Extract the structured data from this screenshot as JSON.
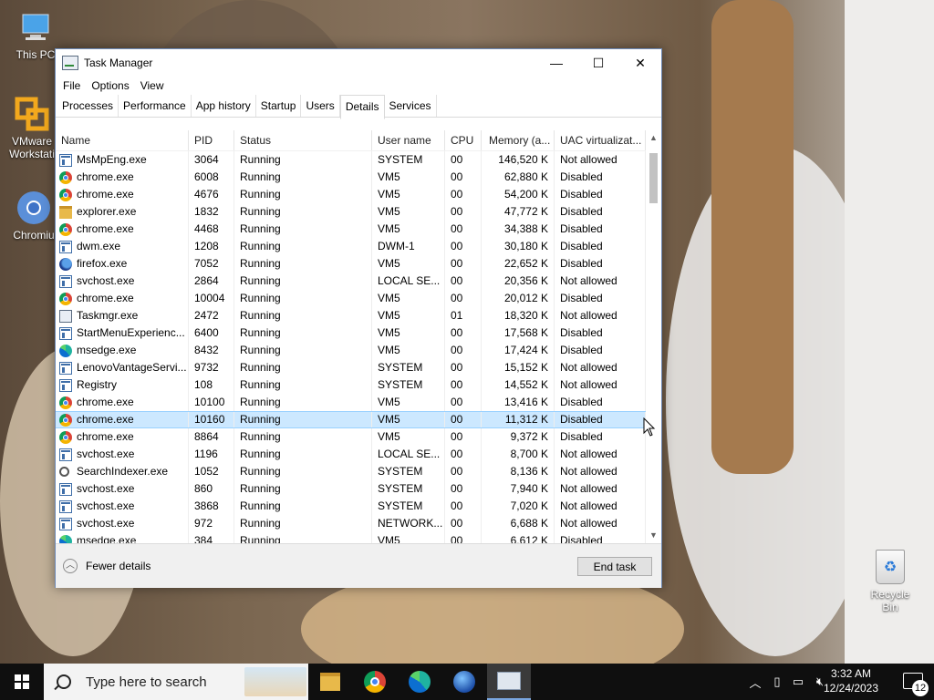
{
  "desktop": {
    "icons": [
      {
        "label": "This PC",
        "icon": "this-pc-icon"
      },
      {
        "label": "VMware Workstati",
        "icon": "vmware-icon"
      },
      {
        "label": "Chromiu",
        "icon": "chromium-icon"
      }
    ],
    "recycle_bin": {
      "label": "Recycle Bin",
      "icon": "recycle-bin-icon"
    }
  },
  "window": {
    "title": "Task Manager",
    "controls": {
      "minimize": "—",
      "maximize": "☐",
      "close": "✕"
    },
    "menu": [
      "File",
      "Options",
      "View"
    ],
    "tabs": [
      "Processes",
      "Performance",
      "App history",
      "Startup",
      "Users",
      "Details",
      "Services"
    ],
    "active_tab": "Details",
    "columns": {
      "name": "Name",
      "pid": "PID",
      "status": "Status",
      "user": "User name",
      "cpu": "CPU",
      "memory": "Memory (a...",
      "uac": "UAC virtualizat..."
    },
    "rows": [
      {
        "icon": "win",
        "name": "MsMpEng.exe",
        "pid": "3064",
        "status": "Running",
        "user": "SYSTEM",
        "cpu": "00",
        "memory": "146,520 K",
        "uac": "Not allowed"
      },
      {
        "icon": "chrome",
        "name": "chrome.exe",
        "pid": "6008",
        "status": "Running",
        "user": "VM5",
        "cpu": "00",
        "memory": "62,880 K",
        "uac": "Disabled"
      },
      {
        "icon": "chrome",
        "name": "chrome.exe",
        "pid": "4676",
        "status": "Running",
        "user": "VM5",
        "cpu": "00",
        "memory": "54,200 K",
        "uac": "Disabled"
      },
      {
        "icon": "folder",
        "name": "explorer.exe",
        "pid": "1832",
        "status": "Running",
        "user": "VM5",
        "cpu": "00",
        "memory": "47,772 K",
        "uac": "Disabled"
      },
      {
        "icon": "chrome",
        "name": "chrome.exe",
        "pid": "4468",
        "status": "Running",
        "user": "VM5",
        "cpu": "00",
        "memory": "34,388 K",
        "uac": "Disabled"
      },
      {
        "icon": "win",
        "name": "dwm.exe",
        "pid": "1208",
        "status": "Running",
        "user": "DWM-1",
        "cpu": "00",
        "memory": "30,180 K",
        "uac": "Disabled"
      },
      {
        "icon": "firefox",
        "name": "firefox.exe",
        "pid": "7052",
        "status": "Running",
        "user": "VM5",
        "cpu": "00",
        "memory": "22,652 K",
        "uac": "Disabled"
      },
      {
        "icon": "win",
        "name": "svchost.exe",
        "pid": "2864",
        "status": "Running",
        "user": "LOCAL SE...",
        "cpu": "00",
        "memory": "20,356 K",
        "uac": "Not allowed"
      },
      {
        "icon": "chrome",
        "name": "chrome.exe",
        "pid": "10004",
        "status": "Running",
        "user": "VM5",
        "cpu": "00",
        "memory": "20,012 K",
        "uac": "Disabled"
      },
      {
        "icon": "tm",
        "name": "Taskmgr.exe",
        "pid": "2472",
        "status": "Running",
        "user": "VM5",
        "cpu": "01",
        "memory": "18,320 K",
        "uac": "Not allowed"
      },
      {
        "icon": "win",
        "name": "StartMenuExperienc...",
        "pid": "6400",
        "status": "Running",
        "user": "VM5",
        "cpu": "00",
        "memory": "17,568 K",
        "uac": "Disabled"
      },
      {
        "icon": "edge",
        "name": "msedge.exe",
        "pid": "8432",
        "status": "Running",
        "user": "VM5",
        "cpu": "00",
        "memory": "17,424 K",
        "uac": "Disabled"
      },
      {
        "icon": "win",
        "name": "LenovoVantageServi...",
        "pid": "9732",
        "status": "Running",
        "user": "SYSTEM",
        "cpu": "00",
        "memory": "15,152 K",
        "uac": "Not allowed"
      },
      {
        "icon": "win",
        "name": "Registry",
        "pid": "108",
        "status": "Running",
        "user": "SYSTEM",
        "cpu": "00",
        "memory": "14,552 K",
        "uac": "Not allowed"
      },
      {
        "icon": "chrome",
        "name": "chrome.exe",
        "pid": "10100",
        "status": "Running",
        "user": "VM5",
        "cpu": "00",
        "memory": "13,416 K",
        "uac": "Disabled"
      },
      {
        "icon": "chrome",
        "name": "chrome.exe",
        "pid": "10160",
        "status": "Running",
        "user": "VM5",
        "cpu": "00",
        "memory": "11,312 K",
        "uac": "Disabled",
        "selected": true
      },
      {
        "icon": "chrome",
        "name": "chrome.exe",
        "pid": "8864",
        "status": "Running",
        "user": "VM5",
        "cpu": "00",
        "memory": "9,372 K",
        "uac": "Disabled"
      },
      {
        "icon": "win",
        "name": "svchost.exe",
        "pid": "1196",
        "status": "Running",
        "user": "LOCAL SE...",
        "cpu": "00",
        "memory": "8,700 K",
        "uac": "Not allowed"
      },
      {
        "icon": "search",
        "name": "SearchIndexer.exe",
        "pid": "1052",
        "status": "Running",
        "user": "SYSTEM",
        "cpu": "00",
        "memory": "8,136 K",
        "uac": "Not allowed"
      },
      {
        "icon": "win",
        "name": "svchost.exe",
        "pid": "860",
        "status": "Running",
        "user": "SYSTEM",
        "cpu": "00",
        "memory": "7,940 K",
        "uac": "Not allowed"
      },
      {
        "icon": "win",
        "name": "svchost.exe",
        "pid": "3868",
        "status": "Running",
        "user": "SYSTEM",
        "cpu": "00",
        "memory": "7,020 K",
        "uac": "Not allowed"
      },
      {
        "icon": "win",
        "name": "svchost.exe",
        "pid": "972",
        "status": "Running",
        "user": "NETWORK...",
        "cpu": "00",
        "memory": "6,688 K",
        "uac": "Not allowed"
      },
      {
        "icon": "edge",
        "name": "msedge.exe",
        "pid": "384",
        "status": "Running",
        "user": "VM5",
        "cpu": "00",
        "memory": "6,612 K",
        "uac": "Disabled"
      }
    ],
    "footer": {
      "fewer_details": "Fewer details",
      "end_task": "End task"
    }
  },
  "taskbar": {
    "search_placeholder": "Type here to search",
    "apps": [
      "file-explorer-icon",
      "chrome-icon",
      "edge-icon",
      "browser-globe-icon",
      "task-manager-icon"
    ],
    "clock_time": "3:32 AM",
    "clock_date": "12/24/2023",
    "notification_count": "12",
    "accent": "#0078d7"
  }
}
